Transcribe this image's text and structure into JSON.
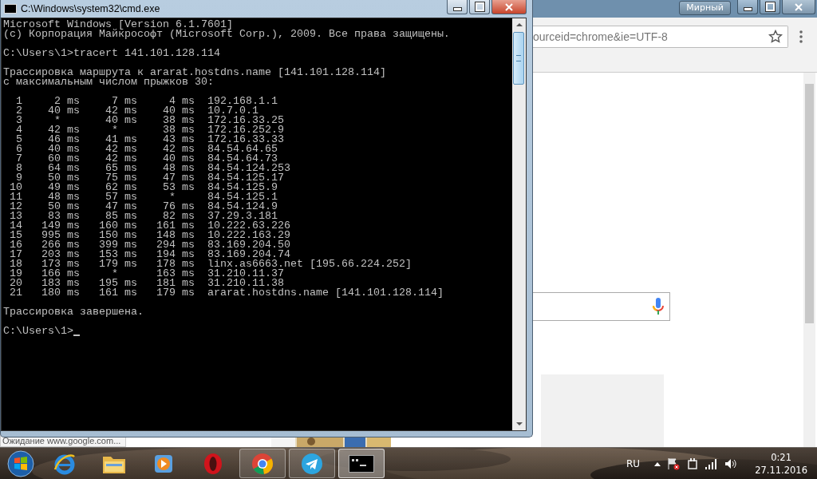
{
  "browser": {
    "profile": "Мирный",
    "address": "ourceid=chrome&ie=UTF-8",
    "status": "Ожидание www.google.com..."
  },
  "console_window": {
    "title": "C:\\Windows\\system32\\cmd.exe",
    "banner": [
      "Microsoft Windows [Version 6.1.7601]",
      "(c) Корпорация Майкрософт (Microsoft Corp.), 2009. Все права защищены."
    ],
    "command": "C:\\Users\\1>tracert 141.101.128.114",
    "trace_header": [
      "Трассировка маршрута к ararat.hostdns.name [141.101.128.114]",
      "с максимальным числом прыжков 30:"
    ],
    "hops": [
      {
        "hop": "1",
        "rtt": [
          {
            "value": "2",
            "unit": "ms"
          },
          {
            "value": "7",
            "unit": "ms"
          },
          {
            "value": "4",
            "unit": "ms"
          }
        ],
        "host": "192.168.1.1"
      },
      {
        "hop": "2",
        "rtt": [
          {
            "value": "40",
            "unit": "ms"
          },
          {
            "value": "42",
            "unit": "ms"
          },
          {
            "value": "40",
            "unit": "ms"
          }
        ],
        "host": "10.7.0.1"
      },
      {
        "hop": "3",
        "rtt": [
          {
            "value": "*"
          },
          {
            "value": "40",
            "unit": "ms"
          },
          {
            "value": "38",
            "unit": "ms"
          }
        ],
        "host": "172.16.33.25"
      },
      {
        "hop": "4",
        "rtt": [
          {
            "value": "42",
            "unit": "ms"
          },
          {
            "value": "*"
          },
          {
            "value": "38",
            "unit": "ms"
          }
        ],
        "host": "172.16.252.9"
      },
      {
        "hop": "5",
        "rtt": [
          {
            "value": "46",
            "unit": "ms"
          },
          {
            "value": "41",
            "unit": "ms"
          },
          {
            "value": "43",
            "unit": "ms"
          }
        ],
        "host": "172.16.33.33"
      },
      {
        "hop": "6",
        "rtt": [
          {
            "value": "40",
            "unit": "ms"
          },
          {
            "value": "42",
            "unit": "ms"
          },
          {
            "value": "42",
            "unit": "ms"
          }
        ],
        "host": "84.54.64.65"
      },
      {
        "hop": "7",
        "rtt": [
          {
            "value": "60",
            "unit": "ms"
          },
          {
            "value": "42",
            "unit": "ms"
          },
          {
            "value": "40",
            "unit": "ms"
          }
        ],
        "host": "84.54.64.73"
      },
      {
        "hop": "8",
        "rtt": [
          {
            "value": "64",
            "unit": "ms"
          },
          {
            "value": "65",
            "unit": "ms"
          },
          {
            "value": "48",
            "unit": "ms"
          }
        ],
        "host": "84.54.124.253"
      },
      {
        "hop": "9",
        "rtt": [
          {
            "value": "50",
            "unit": "ms"
          },
          {
            "value": "75",
            "unit": "ms"
          },
          {
            "value": "47",
            "unit": "ms"
          }
        ],
        "host": "84.54.125.17"
      },
      {
        "hop": "10",
        "rtt": [
          {
            "value": "49",
            "unit": "ms"
          },
          {
            "value": "62",
            "unit": "ms"
          },
          {
            "value": "53",
            "unit": "ms"
          }
        ],
        "host": "84.54.125.9"
      },
      {
        "hop": "11",
        "rtt": [
          {
            "value": "48",
            "unit": "ms"
          },
          {
            "value": "57",
            "unit": "ms"
          },
          {
            "value": "*"
          }
        ],
        "host": "84.54.125.1"
      },
      {
        "hop": "12",
        "rtt": [
          {
            "value": "50",
            "unit": "ms"
          },
          {
            "value": "47",
            "unit": "ms"
          },
          {
            "value": "76",
            "unit": "ms"
          }
        ],
        "host": "84.54.124.9"
      },
      {
        "hop": "13",
        "rtt": [
          {
            "value": "83",
            "unit": "ms"
          },
          {
            "value": "85",
            "unit": "ms"
          },
          {
            "value": "82",
            "unit": "ms"
          }
        ],
        "host": "37.29.3.181"
      },
      {
        "hop": "14",
        "rtt": [
          {
            "value": "149",
            "unit": "ms"
          },
          {
            "value": "160",
            "unit": "ms"
          },
          {
            "value": "161",
            "unit": "ms"
          }
        ],
        "host": "10.222.63.226"
      },
      {
        "hop": "15",
        "rtt": [
          {
            "value": "995",
            "unit": "ms"
          },
          {
            "value": "150",
            "unit": "ms"
          },
          {
            "value": "148",
            "unit": "ms"
          }
        ],
        "host": "10.222.163.29"
      },
      {
        "hop": "16",
        "rtt": [
          {
            "value": "266",
            "unit": "ms"
          },
          {
            "value": "399",
            "unit": "ms"
          },
          {
            "value": "294",
            "unit": "ms"
          }
        ],
        "host": "83.169.204.50"
      },
      {
        "hop": "17",
        "rtt": [
          {
            "value": "203",
            "unit": "ms"
          },
          {
            "value": "153",
            "unit": "ms"
          },
          {
            "value": "194",
            "unit": "ms"
          }
        ],
        "host": "83.169.204.74"
      },
      {
        "hop": "18",
        "rtt": [
          {
            "value": "173",
            "unit": "ms"
          },
          {
            "value": "179",
            "unit": "ms"
          },
          {
            "value": "178",
            "unit": "ms"
          }
        ],
        "host": "linx.as6663.net [195.66.224.252]"
      },
      {
        "hop": "19",
        "rtt": [
          {
            "value": "166",
            "unit": "ms"
          },
          {
            "value": "*"
          },
          {
            "value": "163",
            "unit": "ms"
          }
        ],
        "host": "31.210.11.37"
      },
      {
        "hop": "20",
        "rtt": [
          {
            "value": "183",
            "unit": "ms"
          },
          {
            "value": "195",
            "unit": "ms"
          },
          {
            "value": "181",
            "unit": "ms"
          }
        ],
        "host": "31.210.11.38"
      },
      {
        "hop": "21",
        "rtt": [
          {
            "value": "180",
            "unit": "ms"
          },
          {
            "value": "161",
            "unit": "ms"
          },
          {
            "value": "179",
            "unit": "ms"
          }
        ],
        "host": "ararat.hostdns.name [141.101.128.114]"
      }
    ],
    "done": "Трассировка завершена.",
    "prompt": "C:\\Users\\1>"
  },
  "taskbar": {
    "apps": [
      {
        "kind": "ie",
        "running": false,
        "selected": false
      },
      {
        "kind": "explorer",
        "running": false,
        "selected": false
      },
      {
        "kind": "media",
        "running": false,
        "selected": false
      },
      {
        "kind": "opera",
        "running": false,
        "selected": false
      },
      {
        "kind": "chrome",
        "running": true,
        "selected": false
      },
      {
        "kind": "telegram",
        "running": true,
        "selected": false
      },
      {
        "kind": "cmd",
        "running": true,
        "selected": true
      }
    ],
    "language": "RU",
    "time": "0:21",
    "date": "27.11.2016"
  }
}
